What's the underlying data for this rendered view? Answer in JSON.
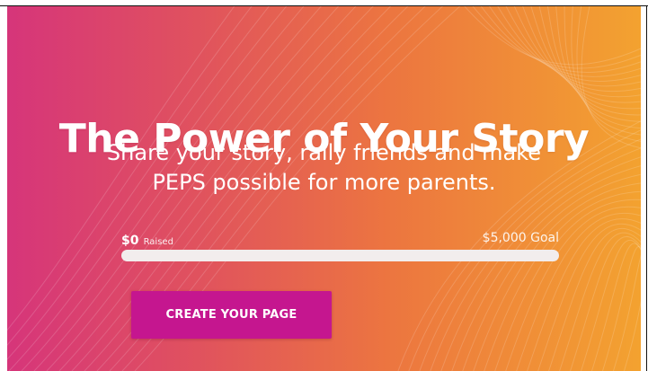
{
  "hero": {
    "headline": "The Power of Your Story",
    "subtitle_line1": "Share your story, rally friends and make",
    "subtitle_line2": "PEPS possible for more parents."
  },
  "fundraising": {
    "raised_amount": "$0",
    "raised_label": "Raised",
    "goal_text": "$5,000 Goal",
    "progress_fraction": 0
  },
  "cta": {
    "label": "CREATE YOUR PAGE"
  },
  "colors": {
    "gradient_start": "#d6357a",
    "gradient_end": "#f3a230",
    "button": "#c5168f",
    "track": "#f2eded",
    "text": "#ffffff"
  }
}
